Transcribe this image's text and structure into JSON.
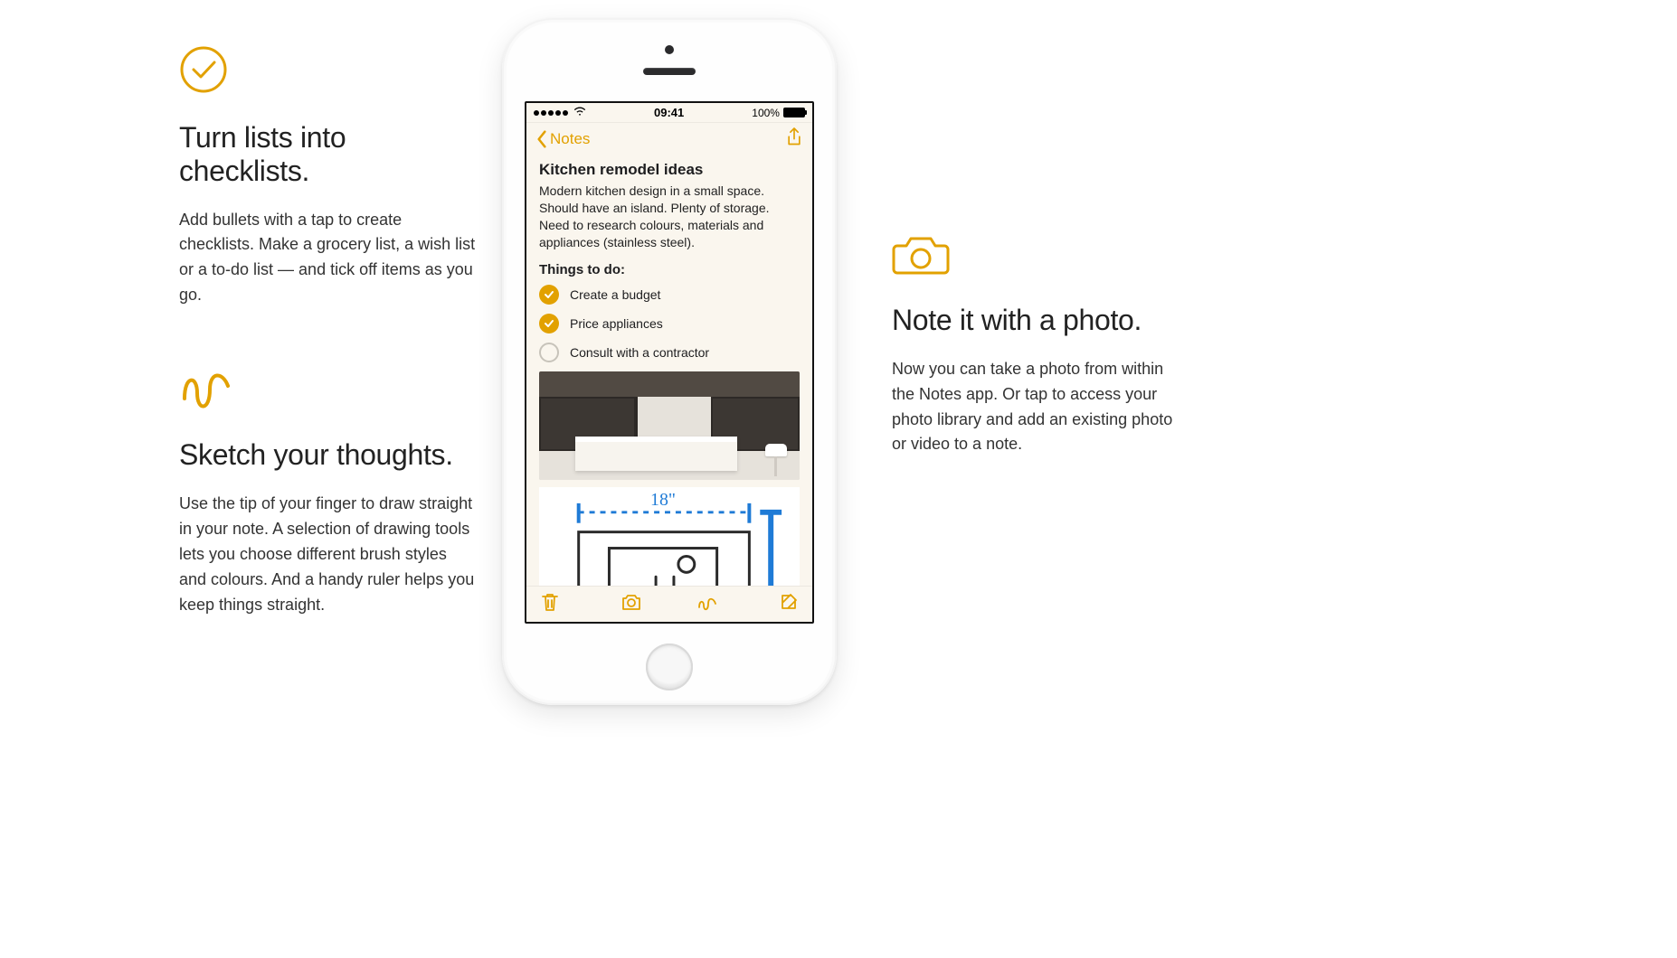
{
  "features": {
    "checklists": {
      "title": "Turn lists into checklists.",
      "body": "Add bullets with a tap to create checklists. Make a grocery list, a wish list or a to-do list — and tick off items as you go."
    },
    "sketch": {
      "title": "Sketch your thoughts.",
      "body": "Use the tip of your finger to draw straight in your note. A selection of drawing tools lets you choose different brush styles and colours. And a handy ruler helps you keep things straight."
    },
    "photo": {
      "title": "Note it with a photo.",
      "body": "Now you can take a photo from within the Notes app. Or tap to access your photo library and add an existing photo or video to a note."
    }
  },
  "phone": {
    "statusbar": {
      "time": "09:41",
      "battery": "100%"
    },
    "navbar": {
      "back_label": "Notes"
    },
    "note": {
      "title": "Kitchen remodel ideas",
      "body": "Modern kitchen design in a small space. Should have an island. Plenty of storage. Need to research colours, materials and appliances (stainless steel).",
      "subhead": "Things to do:",
      "checklist": [
        {
          "label": "Create a budget",
          "checked": true
        },
        {
          "label": "Price appliances",
          "checked": true
        },
        {
          "label": "Consult with a contractor",
          "checked": false
        }
      ],
      "sketch_dimension": "18\""
    }
  },
  "colors": {
    "accent": "#e2a100"
  }
}
